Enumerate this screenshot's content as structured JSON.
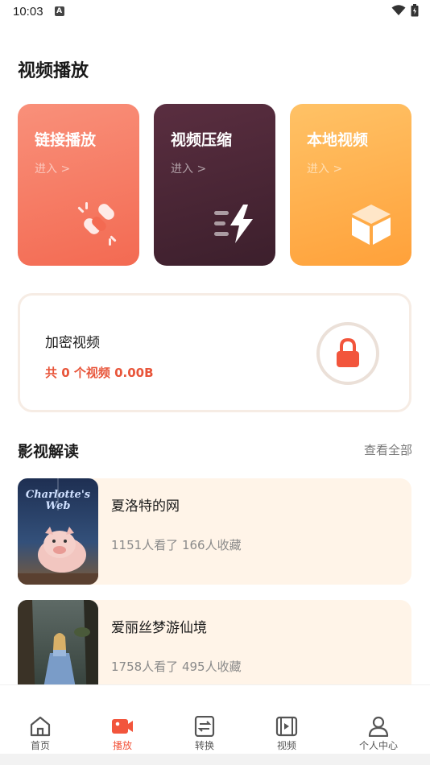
{
  "status": {
    "time": "10:03",
    "notif_glyph": "A"
  },
  "header": {
    "title": "视频播放"
  },
  "feature_cards": [
    {
      "title": "链接播放",
      "enter": "进入 >",
      "icon": "link-icon"
    },
    {
      "title": "视频压缩",
      "enter": "进入 >",
      "icon": "lightning-icon"
    },
    {
      "title": "本地视频",
      "enter": "进入 >",
      "icon": "box-icon"
    }
  ],
  "secure": {
    "title": "加密视频",
    "summary": "共 0 个视频 0.00B",
    "icon": "lock-icon"
  },
  "reviews": {
    "title": "影视解读",
    "view_all": "查看全部",
    "items": [
      {
        "name": "夏洛特的网",
        "stats": "1151人看了 166人收藏",
        "poster_text": "Charlotte's Web"
      },
      {
        "name": "爱丽丝梦游仙境",
        "stats": "1758人看了 495人收藏"
      }
    ]
  },
  "tabbar": {
    "items": [
      {
        "label": "首页",
        "icon": "home-icon"
      },
      {
        "label": "播放",
        "icon": "camera-icon"
      },
      {
        "label": "转换",
        "icon": "convert-icon"
      },
      {
        "label": "视频",
        "icon": "video-icon"
      },
      {
        "label": "个人中心",
        "icon": "user-icon"
      }
    ],
    "active_index": 1
  },
  "colors": {
    "accent": "#f2553c",
    "card_link": "#f36a52",
    "card_compress": "#3c1f2c",
    "card_local": "#ffa13a",
    "movie_bg": "#fff4e8"
  }
}
